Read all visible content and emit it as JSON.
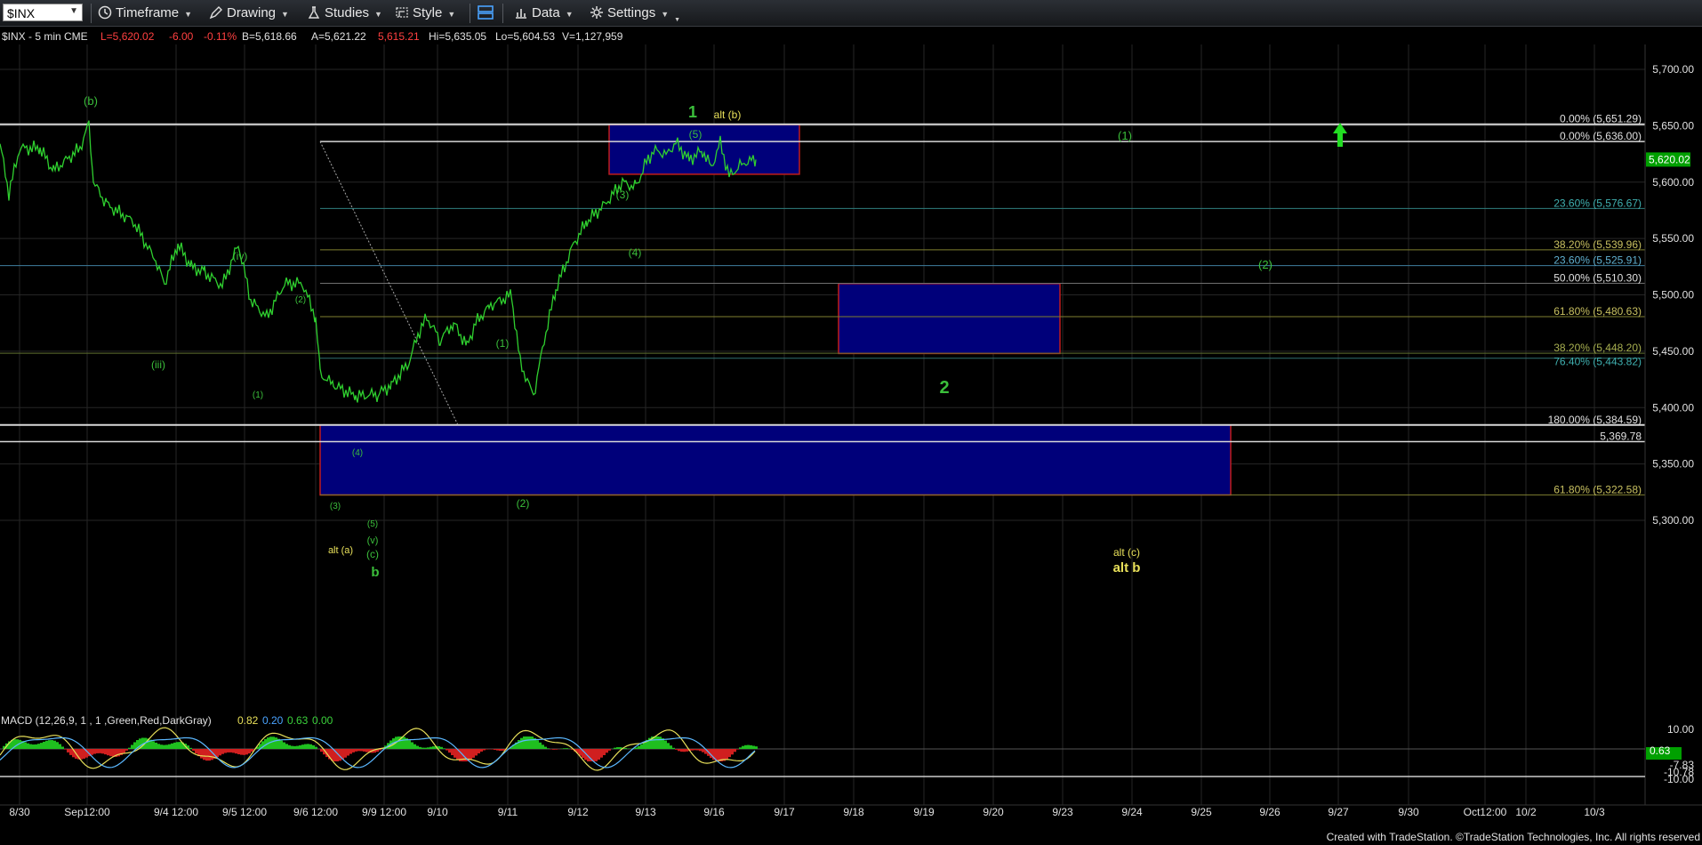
{
  "toolbar": {
    "symbol": "$INX",
    "timeframe": "Timeframe",
    "drawing": "Drawing",
    "studies": "Studies",
    "style": "Style",
    "data": "Data",
    "settings": "Settings"
  },
  "header": {
    "symbol_tf": "$INX - 5 min  CME",
    "last": "L=5,620.02",
    "change": "-6.00",
    "pct": "-0.11%",
    "bid": "B=5,618.66",
    "ask": "A=5,621.22",
    "mid": "5,615.21",
    "high": "Hi=5,635.05",
    "low": "Lo=5,604.53",
    "volume": "V=1,127,959"
  },
  "colors": {
    "up": "#00cc00",
    "down": "#ff2020",
    "wave": "#3bbf3b",
    "yellow": "#e8e05a",
    "box": "#00007a",
    "box_border": "#c01c1c"
  },
  "price_axis": [
    "5,700.00",
    "5,650.00",
    "5,600.00",
    "5,550.00",
    "5,500.00",
    "5,450.00",
    "5,400.00",
    "5,350.00",
    "5,300.00"
  ],
  "last_price_tag": "5,620.02",
  "time_axis": [
    "8/30",
    "Sep12:00",
    "9/4 12:00",
    "9/5 12:00",
    "9/6 12:00",
    "9/9 12:00",
    "9/10",
    "9/11",
    "9/12",
    "9/13",
    "9/16",
    "9/17",
    "9/18",
    "9/19",
    "9/20",
    "9/23",
    "9/24",
    "9/25",
    "9/26",
    "9/27",
    "9/30",
    "Oct12:00",
    "10/2",
    "10/3"
  ],
  "fib_labels": [
    "0.00% (5,651.29)",
    "0.00% (5,636.00)",
    "23.60% (5,576.67)",
    "38.20% (5,539.96)",
    "23.60% (5,525.91)",
    "50.00% (5,510.30)",
    "61.80% (5,480.63)",
    "38.20% (5,448.20)",
    "76.40% (5,443.82)",
    "180.00% (5,384.59)",
    "5,369.78",
    "61.80% (5,322.58)"
  ],
  "wave_labels": [
    "(b)",
    "(iv)",
    "(iii)",
    "(2)",
    "(1)",
    "(4)",
    "(3)",
    "(5)",
    "(v)",
    "(c)",
    "b",
    "alt (a)",
    "(1)",
    "(2)",
    "(3)",
    "(4)",
    "(5)",
    "1",
    "alt (b)",
    "(1)",
    "(2)",
    "2",
    "alt (c)",
    "alt b"
  ],
  "macd": {
    "label": "MACD (12,26,9, 1 , 1 ,Green,Red,DarkGray)",
    "v1": "0.82",
    "v2": "0.20",
    "v3": "0.63",
    "v4": "0.00",
    "axis": [
      "10.00",
      "0.63",
      "-7.83",
      "-10.78",
      "-10.00"
    ]
  },
  "footer": "Created with TradeStation. ©TradeStation Technologies, Inc. All rights reserved"
}
